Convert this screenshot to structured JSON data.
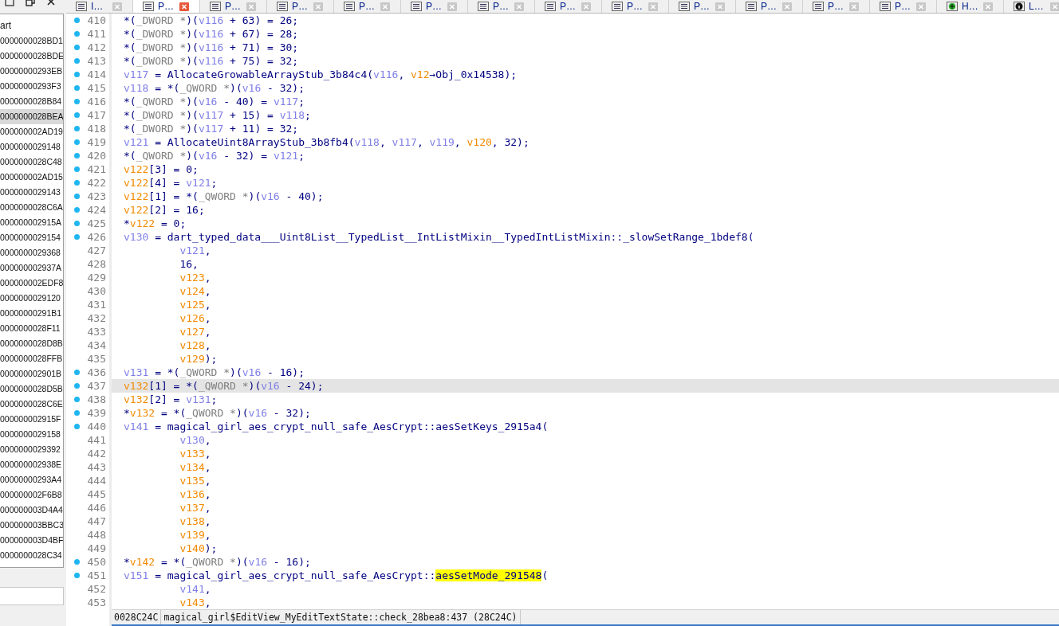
{
  "functions_panel": {
    "header": "art",
    "items": [
      {
        "name": "0000000028BD1",
        "selected": false
      },
      {
        "name": "0000000028BDE",
        "selected": false
      },
      {
        "name": "00000000293EB",
        "selected": false
      },
      {
        "name": "00000000293F3",
        "selected": false
      },
      {
        "name": "0000000028B84",
        "selected": false
      },
      {
        "name": "0000000028BEA",
        "selected": true
      },
      {
        "name": "000000002AD19",
        "selected": false
      },
      {
        "name": "0000000029148",
        "selected": false
      },
      {
        "name": "0000000028C48",
        "selected": false
      },
      {
        "name": "000000002AD15",
        "selected": false
      },
      {
        "name": "0000000029143",
        "selected": false
      },
      {
        "name": "0000000028C6A",
        "selected": false
      },
      {
        "name": "000000002915A",
        "selected": false
      },
      {
        "name": "0000000029154",
        "selected": false
      },
      {
        "name": "0000000029368",
        "selected": false
      },
      {
        "name": "000000002937A",
        "selected": false
      },
      {
        "name": "000000002EDF8",
        "selected": false
      },
      {
        "name": "0000000029120",
        "selected": false
      },
      {
        "name": "00000000291B1",
        "selected": false
      },
      {
        "name": "0000000028F11",
        "selected": false
      },
      {
        "name": "0000000028D8B",
        "selected": false
      },
      {
        "name": "0000000028FFB",
        "selected": false
      },
      {
        "name": "000000002901B",
        "selected": false
      },
      {
        "name": "0000000028D5B",
        "selected": false
      },
      {
        "name": "0000000028C6E",
        "selected": false
      },
      {
        "name": "000000002915F",
        "selected": false
      },
      {
        "name": "0000000029158",
        "selected": false
      },
      {
        "name": "0000000029392",
        "selected": false
      },
      {
        "name": "000000002938E",
        "selected": false
      },
      {
        "name": "00000000293A4",
        "selected": false
      },
      {
        "name": "000000002F6B8",
        "selected": false
      },
      {
        "name": "000000003D4A4",
        "selected": false
      },
      {
        "name": "000000003BBC3",
        "selected": false
      },
      {
        "name": "000000003D4BF",
        "selected": false
      },
      {
        "name": "0000000028C34",
        "selected": false
      }
    ]
  },
  "tabs": [
    {
      "label": "I…",
      "kind": "list",
      "selected": false
    },
    {
      "label": "P…",
      "kind": "list",
      "selected": true
    },
    {
      "label": "P…",
      "kind": "list",
      "selected": false
    },
    {
      "label": "P…",
      "kind": "list",
      "selected": false
    },
    {
      "label": "P…",
      "kind": "list",
      "selected": false
    },
    {
      "label": "P…",
      "kind": "list",
      "selected": false
    },
    {
      "label": "P…",
      "kind": "list",
      "selected": false
    },
    {
      "label": "P…",
      "kind": "list",
      "selected": false
    },
    {
      "label": "P…",
      "kind": "list",
      "selected": false
    },
    {
      "label": "P…",
      "kind": "list",
      "selected": false
    },
    {
      "label": "P…",
      "kind": "list",
      "selected": false
    },
    {
      "label": "P…",
      "kind": "list",
      "selected": false
    },
    {
      "label": "P…",
      "kind": "list",
      "selected": false
    },
    {
      "label": "H…",
      "kind": "graph",
      "selected": false
    },
    {
      "label": "L…",
      "kind": "info",
      "selected": false
    }
  ],
  "code": {
    "lines": [
      {
        "number": "410",
        "dot": true,
        "selected": false,
        "continuation": false,
        "segments": [
          {
            "kind": "plain",
            "text": "*("
          },
          {
            "kind": "type",
            "text": "_DWORD *"
          },
          {
            "kind": "plain",
            "text": ")("
          },
          {
            "kind": "local",
            "text": "v116"
          },
          {
            "kind": "plain",
            "text": " + 63) = 26;"
          }
        ]
      },
      {
        "number": "411",
        "dot": true,
        "selected": false,
        "continuation": false,
        "segments": [
          {
            "kind": "plain",
            "text": "*("
          },
          {
            "kind": "type",
            "text": "_DWORD *"
          },
          {
            "kind": "plain",
            "text": ")("
          },
          {
            "kind": "local",
            "text": "v116"
          },
          {
            "kind": "plain",
            "text": " + 67) = 28;"
          }
        ]
      },
      {
        "number": "412",
        "dot": true,
        "selected": false,
        "continuation": false,
        "segments": [
          {
            "kind": "plain",
            "text": "*("
          },
          {
            "kind": "type",
            "text": "_DWORD *"
          },
          {
            "kind": "plain",
            "text": ")("
          },
          {
            "kind": "local",
            "text": "v116"
          },
          {
            "kind": "plain",
            "text": " + 71) = 30;"
          }
        ]
      },
      {
        "number": "413",
        "dot": true,
        "selected": false,
        "continuation": false,
        "segments": [
          {
            "kind": "plain",
            "text": "*("
          },
          {
            "kind": "type",
            "text": "_DWORD *"
          },
          {
            "kind": "plain",
            "text": ")("
          },
          {
            "kind": "local",
            "text": "v116"
          },
          {
            "kind": "plain",
            "text": " + 75) = 32;"
          }
        ]
      },
      {
        "number": "414",
        "dot": true,
        "selected": false,
        "continuation": false,
        "segments": [
          {
            "kind": "local",
            "text": "v117"
          },
          {
            "kind": "plain",
            "text": " = AllocateGrowableArrayStub_3b84c4("
          },
          {
            "kind": "local",
            "text": "v116"
          },
          {
            "kind": "plain",
            "text": ", "
          },
          {
            "kind": "arg",
            "text": "v12"
          },
          {
            "kind": "plain",
            "text": "→Obj_0x14538);"
          }
        ]
      },
      {
        "number": "415",
        "dot": true,
        "selected": false,
        "continuation": false,
        "segments": [
          {
            "kind": "local",
            "text": "v118"
          },
          {
            "kind": "plain",
            "text": " = *("
          },
          {
            "kind": "type",
            "text": "_QWORD *"
          },
          {
            "kind": "plain",
            "text": ")("
          },
          {
            "kind": "local",
            "text": "v16"
          },
          {
            "kind": "plain",
            "text": " - 32);"
          }
        ]
      },
      {
        "number": "416",
        "dot": true,
        "selected": false,
        "continuation": false,
        "segments": [
          {
            "kind": "plain",
            "text": "*("
          },
          {
            "kind": "type",
            "text": "_QWORD *"
          },
          {
            "kind": "plain",
            "text": ")("
          },
          {
            "kind": "local",
            "text": "v16"
          },
          {
            "kind": "plain",
            "text": " - 40) = "
          },
          {
            "kind": "local",
            "text": "v117"
          },
          {
            "kind": "plain",
            "text": ";"
          }
        ]
      },
      {
        "number": "417",
        "dot": true,
        "selected": false,
        "continuation": false,
        "segments": [
          {
            "kind": "plain",
            "text": "*("
          },
          {
            "kind": "type",
            "text": "_DWORD *"
          },
          {
            "kind": "plain",
            "text": ")("
          },
          {
            "kind": "local",
            "text": "v117"
          },
          {
            "kind": "plain",
            "text": " + 15) = "
          },
          {
            "kind": "local",
            "text": "v118"
          },
          {
            "kind": "plain",
            "text": ";"
          }
        ]
      },
      {
        "number": "418",
        "dot": true,
        "selected": false,
        "continuation": false,
        "segments": [
          {
            "kind": "plain",
            "text": "*("
          },
          {
            "kind": "type",
            "text": "_DWORD *"
          },
          {
            "kind": "plain",
            "text": ")("
          },
          {
            "kind": "local",
            "text": "v117"
          },
          {
            "kind": "plain",
            "text": " + 11) = 32;"
          }
        ]
      },
      {
        "number": "419",
        "dot": true,
        "selected": false,
        "continuation": false,
        "segments": [
          {
            "kind": "local",
            "text": "v121"
          },
          {
            "kind": "plain",
            "text": " = AllocateUint8ArrayStub_3b8fb4("
          },
          {
            "kind": "local",
            "text": "v118"
          },
          {
            "kind": "plain",
            "text": ", "
          },
          {
            "kind": "local",
            "text": "v117"
          },
          {
            "kind": "plain",
            "text": ", "
          },
          {
            "kind": "local",
            "text": "v119"
          },
          {
            "kind": "plain",
            "text": ", "
          },
          {
            "kind": "arg",
            "text": "v120"
          },
          {
            "kind": "plain",
            "text": ", 32);"
          }
        ]
      },
      {
        "number": "420",
        "dot": true,
        "selected": false,
        "continuation": false,
        "segments": [
          {
            "kind": "plain",
            "text": "*("
          },
          {
            "kind": "type",
            "text": "_QWORD *"
          },
          {
            "kind": "plain",
            "text": ")("
          },
          {
            "kind": "local",
            "text": "v16"
          },
          {
            "kind": "plain",
            "text": " - 32) = "
          },
          {
            "kind": "local",
            "text": "v121"
          },
          {
            "kind": "plain",
            "text": ";"
          }
        ]
      },
      {
        "number": "421",
        "dot": true,
        "selected": false,
        "continuation": false,
        "segments": [
          {
            "kind": "arg",
            "text": "v122"
          },
          {
            "kind": "plain",
            "text": "[3] = 0;"
          }
        ]
      },
      {
        "number": "422",
        "dot": true,
        "selected": false,
        "continuation": false,
        "segments": [
          {
            "kind": "arg",
            "text": "v122"
          },
          {
            "kind": "plain",
            "text": "[4] = "
          },
          {
            "kind": "local",
            "text": "v121"
          },
          {
            "kind": "plain",
            "text": ";"
          }
        ]
      },
      {
        "number": "423",
        "dot": true,
        "selected": false,
        "continuation": false,
        "segments": [
          {
            "kind": "arg",
            "text": "v122"
          },
          {
            "kind": "plain",
            "text": "[1] = *("
          },
          {
            "kind": "type",
            "text": "_QWORD *"
          },
          {
            "kind": "plain",
            "text": ")("
          },
          {
            "kind": "local",
            "text": "v16"
          },
          {
            "kind": "plain",
            "text": " - 40);"
          }
        ]
      },
      {
        "number": "424",
        "dot": true,
        "selected": false,
        "continuation": false,
        "segments": [
          {
            "kind": "arg",
            "text": "v122"
          },
          {
            "kind": "plain",
            "text": "[2] = 16;"
          }
        ]
      },
      {
        "number": "425",
        "dot": true,
        "selected": false,
        "continuation": false,
        "segments": [
          {
            "kind": "plain",
            "text": "*"
          },
          {
            "kind": "arg",
            "text": "v122"
          },
          {
            "kind": "plain",
            "text": " = 0;"
          }
        ]
      },
      {
        "number": "426",
        "dot": true,
        "selected": false,
        "continuation": false,
        "segments": [
          {
            "kind": "local",
            "text": "v130"
          },
          {
            "kind": "plain",
            "text": " = dart_typed_data___Uint8List__TypedList__IntListMixin__TypedIntListMixin::_slowSetRange_1bdef8("
          }
        ]
      },
      {
        "number": "427",
        "dot": false,
        "selected": false,
        "continuation": true,
        "segments": [
          {
            "kind": "local",
            "text": "v121"
          },
          {
            "kind": "plain",
            "text": ","
          }
        ]
      },
      {
        "number": "428",
        "dot": false,
        "selected": false,
        "continuation": true,
        "segments": [
          {
            "kind": "plain",
            "text": "16,"
          }
        ]
      },
      {
        "number": "429",
        "dot": false,
        "selected": false,
        "continuation": true,
        "segments": [
          {
            "kind": "arg",
            "text": "v123"
          },
          {
            "kind": "plain",
            "text": ","
          }
        ]
      },
      {
        "number": "430",
        "dot": false,
        "selected": false,
        "continuation": true,
        "segments": [
          {
            "kind": "arg",
            "text": "v124"
          },
          {
            "kind": "plain",
            "text": ","
          }
        ]
      },
      {
        "number": "431",
        "dot": false,
        "selected": false,
        "continuation": true,
        "segments": [
          {
            "kind": "arg",
            "text": "v125"
          },
          {
            "kind": "plain",
            "text": ","
          }
        ]
      },
      {
        "number": "432",
        "dot": false,
        "selected": false,
        "continuation": true,
        "segments": [
          {
            "kind": "arg",
            "text": "v126"
          },
          {
            "kind": "plain",
            "text": ","
          }
        ]
      },
      {
        "number": "433",
        "dot": false,
        "selected": false,
        "continuation": true,
        "segments": [
          {
            "kind": "arg",
            "text": "v127"
          },
          {
            "kind": "plain",
            "text": ","
          }
        ]
      },
      {
        "number": "434",
        "dot": false,
        "selected": false,
        "continuation": true,
        "segments": [
          {
            "kind": "arg",
            "text": "v128"
          },
          {
            "kind": "plain",
            "text": ","
          }
        ]
      },
      {
        "number": "435",
        "dot": false,
        "selected": false,
        "continuation": true,
        "segments": [
          {
            "kind": "arg",
            "text": "v129"
          },
          {
            "kind": "plain",
            "text": ");"
          }
        ]
      },
      {
        "number": "436",
        "dot": true,
        "selected": false,
        "continuation": false,
        "segments": [
          {
            "kind": "local",
            "text": "v131"
          },
          {
            "kind": "plain",
            "text": " = *("
          },
          {
            "kind": "type",
            "text": "_QWORD *"
          },
          {
            "kind": "plain",
            "text": ")("
          },
          {
            "kind": "local",
            "text": "v16"
          },
          {
            "kind": "plain",
            "text": " - 16);"
          }
        ]
      },
      {
        "number": "437",
        "dot": true,
        "selected": true,
        "continuation": false,
        "segments": [
          {
            "kind": "arg",
            "text": "v132"
          },
          {
            "kind": "plain",
            "text": "[1] = *("
          },
          {
            "kind": "type",
            "text": "_QWORD *"
          },
          {
            "kind": "plain",
            "text": ")("
          },
          {
            "kind": "local",
            "text": "v16"
          },
          {
            "kind": "plain",
            "text": " - 24);"
          }
        ]
      },
      {
        "number": "438",
        "dot": true,
        "selected": false,
        "continuation": false,
        "segments": [
          {
            "kind": "arg",
            "text": "v132"
          },
          {
            "kind": "plain",
            "text": "[2] = "
          },
          {
            "kind": "local",
            "text": "v131"
          },
          {
            "kind": "plain",
            "text": ";"
          }
        ]
      },
      {
        "number": "439",
        "dot": true,
        "selected": false,
        "continuation": false,
        "segments": [
          {
            "kind": "plain",
            "text": "*"
          },
          {
            "kind": "arg",
            "text": "v132"
          },
          {
            "kind": "plain",
            "text": " = *("
          },
          {
            "kind": "type",
            "text": "_QWORD *"
          },
          {
            "kind": "plain",
            "text": ")("
          },
          {
            "kind": "local",
            "text": "v16"
          },
          {
            "kind": "plain",
            "text": " - 32);"
          }
        ]
      },
      {
        "number": "440",
        "dot": true,
        "selected": false,
        "continuation": false,
        "segments": [
          {
            "kind": "local",
            "text": "v141"
          },
          {
            "kind": "plain",
            "text": " = magical_girl_aes_crypt_null_safe_AesCrypt::aesSetKeys_2915a4("
          }
        ]
      },
      {
        "number": "441",
        "dot": false,
        "selected": false,
        "continuation": true,
        "segments": [
          {
            "kind": "local",
            "text": "v130"
          },
          {
            "kind": "plain",
            "text": ","
          }
        ]
      },
      {
        "number": "442",
        "dot": false,
        "selected": false,
        "continuation": true,
        "segments": [
          {
            "kind": "arg",
            "text": "v133"
          },
          {
            "kind": "plain",
            "text": ","
          }
        ]
      },
      {
        "number": "443",
        "dot": false,
        "selected": false,
        "continuation": true,
        "segments": [
          {
            "kind": "arg",
            "text": "v134"
          },
          {
            "kind": "plain",
            "text": ","
          }
        ]
      },
      {
        "number": "444",
        "dot": false,
        "selected": false,
        "continuation": true,
        "segments": [
          {
            "kind": "arg",
            "text": "v135"
          },
          {
            "kind": "plain",
            "text": ","
          }
        ]
      },
      {
        "number": "445",
        "dot": false,
        "selected": false,
        "continuation": true,
        "segments": [
          {
            "kind": "arg",
            "text": "v136"
          },
          {
            "kind": "plain",
            "text": ","
          }
        ]
      },
      {
        "number": "446",
        "dot": false,
        "selected": false,
        "continuation": true,
        "segments": [
          {
            "kind": "arg",
            "text": "v137"
          },
          {
            "kind": "plain",
            "text": ","
          }
        ]
      },
      {
        "number": "447",
        "dot": false,
        "selected": false,
        "continuation": true,
        "segments": [
          {
            "kind": "arg",
            "text": "v138"
          },
          {
            "kind": "plain",
            "text": ","
          }
        ]
      },
      {
        "number": "448",
        "dot": false,
        "selected": false,
        "continuation": true,
        "segments": [
          {
            "kind": "arg",
            "text": "v139"
          },
          {
            "kind": "plain",
            "text": ","
          }
        ]
      },
      {
        "number": "449",
        "dot": false,
        "selected": false,
        "continuation": true,
        "segments": [
          {
            "kind": "arg",
            "text": "v140"
          },
          {
            "kind": "plain",
            "text": ");"
          }
        ]
      },
      {
        "number": "450",
        "dot": true,
        "selected": false,
        "continuation": false,
        "segments": [
          {
            "kind": "plain",
            "text": "*"
          },
          {
            "kind": "arg",
            "text": "v142"
          },
          {
            "kind": "plain",
            "text": " = *("
          },
          {
            "kind": "type",
            "text": "_QWORD *"
          },
          {
            "kind": "plain",
            "text": ")("
          },
          {
            "kind": "local",
            "text": "v16"
          },
          {
            "kind": "plain",
            "text": " - 16);"
          }
        ]
      },
      {
        "number": "451",
        "dot": true,
        "selected": false,
        "continuation": false,
        "segments": [
          {
            "kind": "local",
            "text": "v151"
          },
          {
            "kind": "plain",
            "text": " = magical_girl_aes_crypt_null_safe_AesCrypt::"
          },
          {
            "kind": "highlight",
            "text": "aesSetMode_291548"
          },
          {
            "kind": "plain",
            "text": "("
          }
        ]
      },
      {
        "number": "452",
        "dot": false,
        "selected": false,
        "continuation": true,
        "segments": [
          {
            "kind": "local",
            "text": "v141"
          },
          {
            "kind": "plain",
            "text": ","
          }
        ]
      },
      {
        "number": "453",
        "dot": false,
        "selected": false,
        "continuation": true,
        "segments": [
          {
            "kind": "arg",
            "text": "v143"
          },
          {
            "kind": "plain",
            "text": ","
          }
        ]
      }
    ]
  },
  "status_bar": {
    "address": "0028C24C",
    "location": "magical_girl$EditView_MyEditTextState::check_28bea8:437 (28C24C)"
  }
}
